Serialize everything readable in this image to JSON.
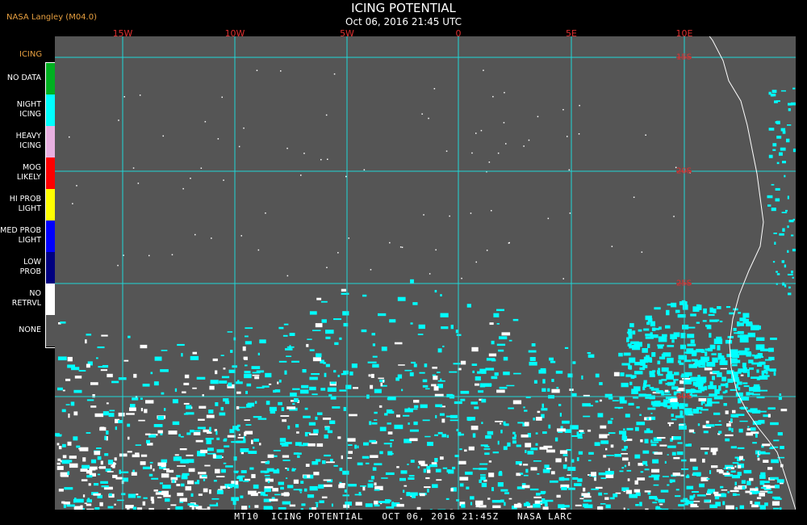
{
  "header": {
    "source": "NASA Langley (M04.0)",
    "title": "ICING POTENTIAL",
    "subtitle": "Oct 06, 2016 21:45 UTC"
  },
  "map": {
    "background_color": "#555555",
    "grid_color": "#20d8d8",
    "coast_color": "#ffffff",
    "longitudes": [
      "15W",
      "10W",
      "5W",
      "0",
      "5E",
      "10E"
    ],
    "latitudes": [
      "15S",
      "20S",
      "25S",
      "30S"
    ],
    "colors": {
      "night_icing": "#00ffff",
      "no_retrieval": "#ffffff"
    }
  },
  "legend": {
    "title": "ICING",
    "items": [
      {
        "label_lines": [
          "NO DATA"
        ],
        "color": "#00b020"
      },
      {
        "label_lines": [
          "NIGHT",
          "ICING"
        ],
        "color": "#00ffff"
      },
      {
        "label_lines": [
          "HEAVY",
          "ICING"
        ],
        "color": "#e8b0e0"
      },
      {
        "label_lines": [
          "MOG",
          "LIKELY"
        ],
        "color": "#ff0000"
      },
      {
        "label_lines": [
          "HI PROB",
          "LIGHT"
        ],
        "color": "#ffff00"
      },
      {
        "label_lines": [
          "MED PROB",
          "LIGHT"
        ],
        "color": "#0000ff"
      },
      {
        "label_lines": [
          "LOW",
          "PROB"
        ],
        "color": "#000080"
      },
      {
        "label_lines": [
          "NO",
          "RETRVL"
        ],
        "color": "#ffffff"
      },
      {
        "label_lines": [
          "NONE"
        ],
        "color": "#555555"
      }
    ]
  },
  "footer": {
    "text": "MT10  ICING POTENTIAL   OCT 06, 2016 21:45Z   NASA LARC"
  }
}
